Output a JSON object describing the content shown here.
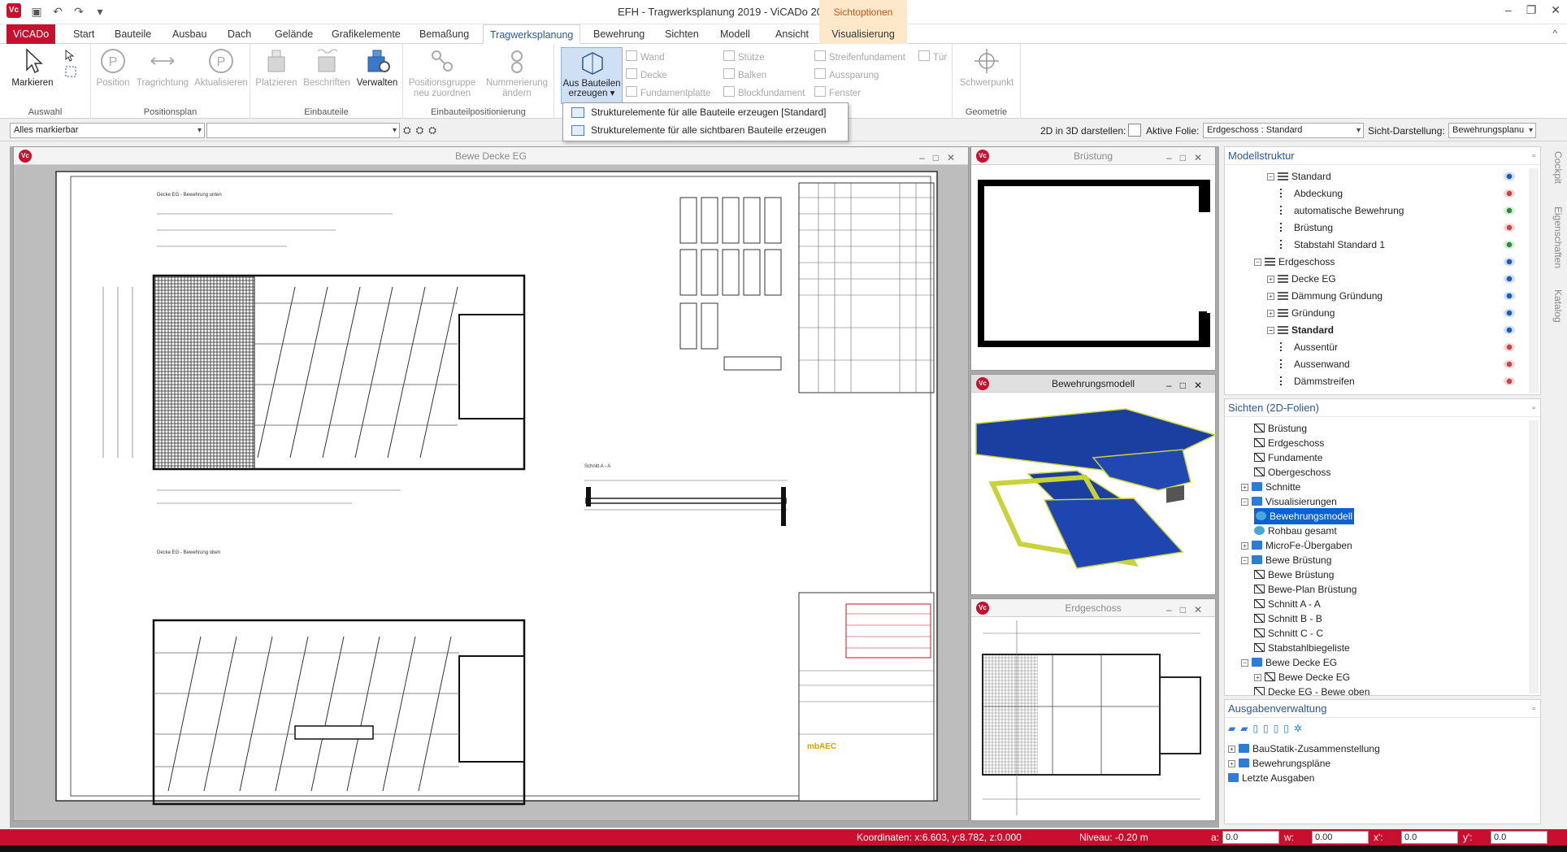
{
  "window": {
    "title": "EFH - Tragwerksplanung 2019 - ViCADo 2019",
    "context_tab_group": "Sichtoptionen",
    "app_logo": "Vc"
  },
  "ribbon_tabs": [
    {
      "label": "ViCADo"
    },
    {
      "label": "Start"
    },
    {
      "label": "Bauteile"
    },
    {
      "label": "Ausbau"
    },
    {
      "label": "Dach"
    },
    {
      "label": "Gelände"
    },
    {
      "label": "Grafikelemente"
    },
    {
      "label": "Bemaßung"
    },
    {
      "label": "Tragwerksplanung"
    },
    {
      "label": "Bewehrung"
    },
    {
      "label": "Sichten"
    },
    {
      "label": "Modell"
    },
    {
      "label": "Ansicht"
    },
    {
      "label": "Visualisierung"
    }
  ],
  "ribbon": {
    "auswahl": {
      "label": "Auswahl",
      "markieren": "Markieren"
    },
    "positionsplan": {
      "label": "Positionsplan",
      "position": "Position",
      "tragrichtung": "Tragrichtung",
      "aktualisieren": "Aktualisieren"
    },
    "einbauteile": {
      "label": "Einbauteile",
      "platzieren": "Platzieren",
      "beschriften": "Beschriften",
      "verwalten": "Verwalten"
    },
    "einbauteilpositionierung": {
      "label": "Einbauteilpositionierung",
      "positionsgruppe_1": "Positionsgruppe",
      "positionsgruppe_2": "neu zuordnen",
      "nummerierung_1": "Nummerierung",
      "nummerierung_2": "ändern"
    },
    "aus_bauteilen": {
      "line1": "Aus Bauteilen",
      "line2": "erzeugen ▾"
    },
    "small_col1": [
      "Wand",
      "Decke",
      "Fundamentplatte"
    ],
    "small_col2": [
      "Stütze",
      "Balken",
      "Blockfundament"
    ],
    "small_col3": [
      "Streifenfundament",
      "Aussparung",
      "Fenster"
    ],
    "tuer": "Tür",
    "geometrie": {
      "label": "Geometrie",
      "schwerpunkt": "Schwerpunkt"
    }
  },
  "dropdown": {
    "items": [
      "Strukturelemente für alle Bauteile erzeugen [Standard]",
      "Strukturelemente für alle sichtbaren Bauteile erzeugen"
    ]
  },
  "toolbar": {
    "selection_filter": "Alles markierbar",
    "label_2d3d": "2D in 3D darstellen:",
    "label_aktive_folie": "Aktive Folie:",
    "aktive_folie_value": "Erdgeschoss : Standard",
    "label_sicht": "Sicht-Darstellung:",
    "sicht_value": "Bewehrungsplanu"
  },
  "documents": {
    "main": "Bewe Decke EG",
    "bruestung": "Brüstung",
    "bewehrungsmodell": "Bewehrungsmodell",
    "erdgeschoss": "Erdgeschoss"
  },
  "drawing_labels": {
    "top_plan": "Decke EG - Bewehrung unten",
    "bottom_plan": "Decke EG - Bewehrung oben",
    "section": "Schnitt A - A",
    "stamp_logo": "mbAEC"
  },
  "modellstruktur": {
    "title": "Modellstruktur",
    "rows": [
      {
        "label": "Standard",
        "indent": 3,
        "icon": "layer",
        "exp": "⊟",
        "eye": "on",
        "bold": false
      },
      {
        "label": "Abdeckung",
        "indent": 4,
        "icon": "list",
        "eye": "off"
      },
      {
        "label": "automatische Bewehrung",
        "indent": 4,
        "icon": "list",
        "eye": "green"
      },
      {
        "label": "Brüstung",
        "indent": 4,
        "icon": "list",
        "eye": "off"
      },
      {
        "label": "Stabstahl Standard 1",
        "indent": 4,
        "icon": "list",
        "eye": "green"
      },
      {
        "label": "Erdgeschoss",
        "indent": 2,
        "icon": "layer",
        "exp": "⊟",
        "eye": "on"
      },
      {
        "label": "Decke EG",
        "indent": 3,
        "icon": "layer",
        "exp": "⊞",
        "eye": "on"
      },
      {
        "label": "Dämmung Gründung",
        "indent": 3,
        "icon": "layer",
        "exp": "⊞",
        "eye": "on"
      },
      {
        "label": "Gründung",
        "indent": 3,
        "icon": "layer",
        "exp": "⊞",
        "eye": "on"
      },
      {
        "label": "Standard",
        "indent": 3,
        "icon": "layer",
        "exp": "⊟",
        "eye": "on",
        "bold": true
      },
      {
        "label": "Aussentür",
        "indent": 4,
        "icon": "list",
        "eye": "off"
      },
      {
        "label": "Aussenwand",
        "indent": 4,
        "icon": "list",
        "eye": "off"
      },
      {
        "label": "Dämmstreifen",
        "indent": 4,
        "icon": "list",
        "eye": "off"
      }
    ]
  },
  "sichten": {
    "title": "Sichten (2D-Folien)",
    "rows": [
      {
        "label": "Brüstung",
        "indent": 2,
        "icon": "view"
      },
      {
        "label": "Erdgeschoss",
        "indent": 2,
        "icon": "view"
      },
      {
        "label": "Fundamente",
        "indent": 2,
        "icon": "view"
      },
      {
        "label": "Obergeschoss",
        "indent": 2,
        "icon": "view"
      },
      {
        "label": "Schnitte",
        "indent": 1,
        "icon": "folder",
        "exp": "⊞"
      },
      {
        "label": "Visualisierungen",
        "indent": 1,
        "icon": "folder",
        "exp": "⊟"
      },
      {
        "label": "Bewehrungsmodell",
        "indent": 2,
        "icon": "viz",
        "selected": true
      },
      {
        "label": "Rohbau gesamt",
        "indent": 2,
        "icon": "viz"
      },
      {
        "label": "MicroFe-Übergaben",
        "indent": 1,
        "icon": "folder",
        "exp": "⊞"
      },
      {
        "label": "Bewe Brüstung",
        "indent": 1,
        "icon": "folder",
        "exp": "⊟"
      },
      {
        "label": "Bewe Brüstung",
        "indent": 2,
        "icon": "view"
      },
      {
        "label": "Bewe-Plan Brüstung",
        "indent": 2,
        "icon": "view"
      },
      {
        "label": "Schnitt A - A",
        "indent": 2,
        "icon": "view"
      },
      {
        "label": "Schnitt B - B",
        "indent": 2,
        "icon": "view"
      },
      {
        "label": "Schnitt C - C",
        "indent": 2,
        "icon": "view"
      },
      {
        "label": "Stabstahlbiegeliste",
        "indent": 2,
        "icon": "view"
      },
      {
        "label": "Bewe Decke EG",
        "indent": 1,
        "icon": "folder",
        "exp": "⊟"
      },
      {
        "label": "Bewe Decke EG",
        "indent": 2,
        "icon": "view",
        "exp": "⊞"
      },
      {
        "label": "Decke EG - Bewe oben",
        "indent": 2,
        "icon": "view"
      }
    ]
  },
  "ausgaben": {
    "title": "Ausgabenverwaltung",
    "rows": [
      {
        "label": "BauStatik-Zusammenstellung",
        "exp": "⊞"
      },
      {
        "label": "Bewehrungspläne",
        "exp": "⊞"
      },
      {
        "label": "Letzte Ausgaben",
        "exp": ""
      }
    ]
  },
  "side_tabs": [
    "Cockpit",
    "Eigenschaften",
    "Katalog"
  ],
  "statusbar": {
    "coords": "Koordinaten: x:6.603, y:8.782, z:0.000",
    "niveau": "Niveau: -0.20 m",
    "a_label": "a:",
    "a_value": "0.0",
    "w_label": "w:",
    "w_value": "0.00",
    "x_label": "x':",
    "x_value": "0.0",
    "y_label": "y':",
    "y_value": "0.0"
  },
  "colors": {
    "brand_red": "#c8102e",
    "accent_blue": "#2b5797",
    "context_orange": "#fde9c9"
  }
}
